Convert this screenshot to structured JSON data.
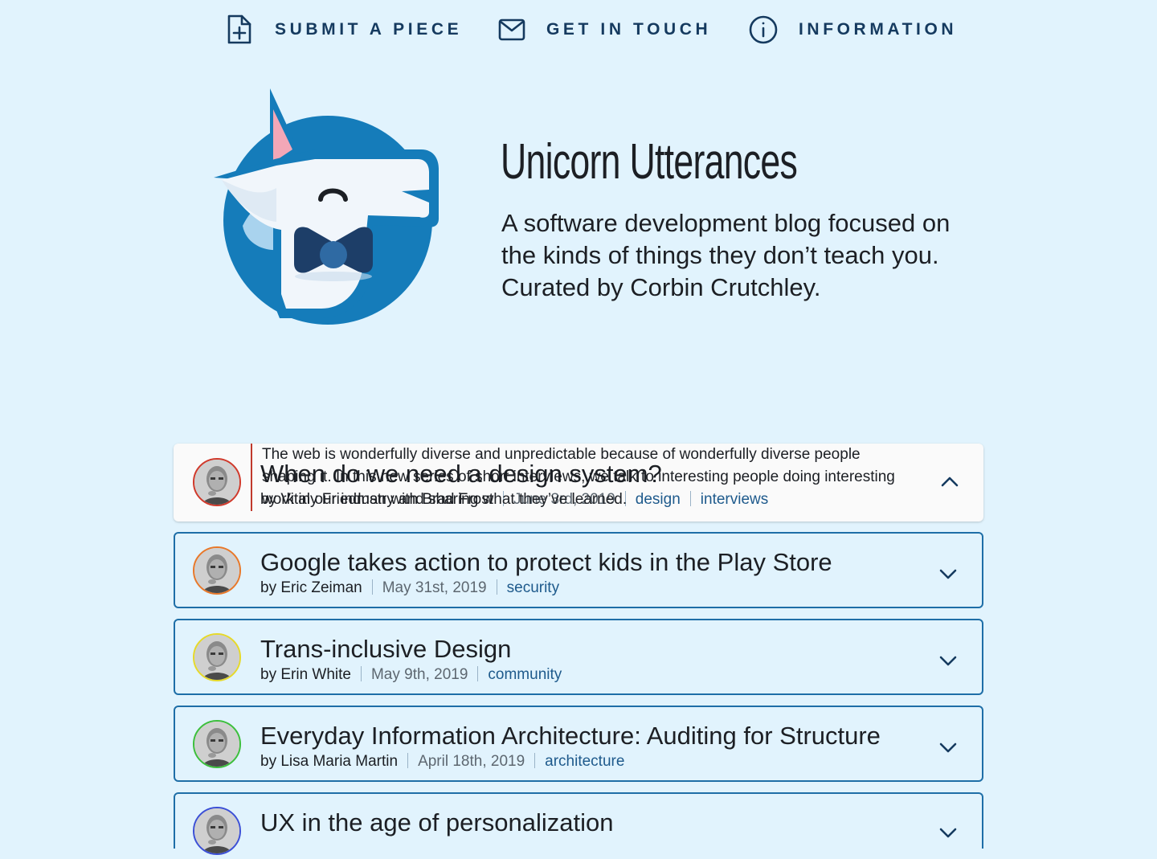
{
  "nav": {
    "items": [
      {
        "label": "SUBMIT A PIECE",
        "icon": "file-plus-icon"
      },
      {
        "label": "GET IN TOUCH",
        "icon": "mail-icon"
      },
      {
        "label": "INFORMATION",
        "icon": "info-circle-icon"
      }
    ]
  },
  "hero": {
    "logo": "unicorn-logo",
    "title": "Unicorn Utterances",
    "description": "A software development blog focused on the kinds of things they don’t teach you. Curated by Corbin Crutchley."
  },
  "colors": {
    "page_background": "#e1f3fd",
    "nav_text": "#153a5f",
    "card_border": "#1e6ea7",
    "tag_link": "#1e5a8c",
    "expanded_card_background": "#fafafa",
    "excerpt_rule": "#c0392b"
  },
  "posts": [
    {
      "title": "When do we need a design system?",
      "author": "by Vitaly Friedman with Brad Frost",
      "date": "June 3rd, 2019",
      "tags": [
        "design",
        "interviews"
      ],
      "excerpt": "The web is wonderfully diverse and unpredictable because of wonderfully diverse people shaping it. In this new series of short interviews, we talk to interesting people doing interesting work in our industry and sharing what they’ve learned.",
      "expanded": true,
      "avatar_ring_color": "#d0392b",
      "chevron": "chevron-up-icon"
    },
    {
      "title": "Google takes action to protect kids in the Play Store",
      "author": "by Eric Zeiman",
      "date": "May 31st, 2019",
      "tags": [
        "security"
      ],
      "expanded": false,
      "avatar_ring_color": "#e8782a",
      "chevron": "chevron-down-icon"
    },
    {
      "title": "Trans-inclusive Design",
      "author": "by Erin White",
      "date": "May 9th, 2019",
      "tags": [
        "community"
      ],
      "expanded": false,
      "avatar_ring_color": "#e6d92a",
      "chevron": "chevron-down-icon"
    },
    {
      "title": "Everyday Information Architecture: Auditing for Structure",
      "author": "by Lisa Maria Martin",
      "date": "April 18th, 2019",
      "tags": [
        "architecture"
      ],
      "expanded": false,
      "avatar_ring_color": "#3cbf3c",
      "chevron": "chevron-down-icon"
    },
    {
      "title": "UX in the age of personalization",
      "expanded": false,
      "avatar_ring_color": "#3b4fd6",
      "chevron": "chevron-down-icon"
    }
  ]
}
